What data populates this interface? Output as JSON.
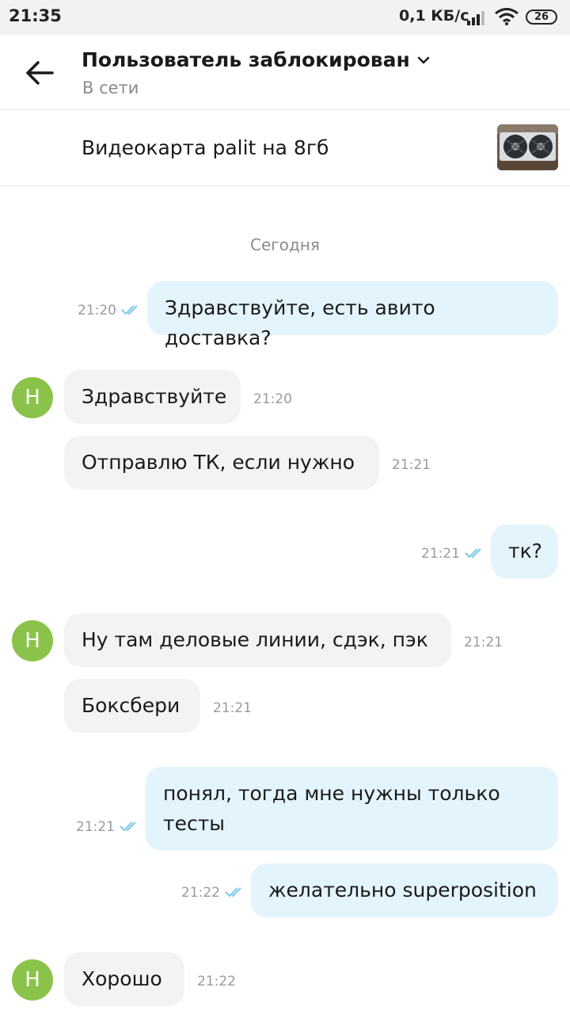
{
  "status_bar": {
    "time": "21:35",
    "network_speed": "0,1 КБ/с",
    "battery": "26"
  },
  "header": {
    "contact_name": "Пользователь заблокирован",
    "contact_status": "В сети"
  },
  "item_banner": {
    "title": "Видеокарта palit на 8гб"
  },
  "chat": {
    "date_divider": "Сегодня",
    "avatar_letter": "Н",
    "messages": [
      {
        "direction": "out",
        "text": "Здравствуйте, есть авито доставка?",
        "time": "21:20",
        "status": "read"
      },
      {
        "direction": "in",
        "text": "Здравствуйте",
        "time": "21:20"
      },
      {
        "direction": "in",
        "text": "Отправлю ТК, если нужно",
        "time": "21:21"
      },
      {
        "direction": "out",
        "text": "тк?",
        "time": "21:21",
        "status": "read"
      },
      {
        "direction": "in",
        "text": "Ну там деловые линии, сдэк, пэк",
        "time": "21:21"
      },
      {
        "direction": "in",
        "text": "Боксбери",
        "time": "21:21"
      },
      {
        "direction": "out",
        "text": "понял, тогда мне нужны только тесты",
        "time": "21:21",
        "status": "read"
      },
      {
        "direction": "out",
        "text": "желательно superposition",
        "time": "21:22",
        "status": "read"
      },
      {
        "direction": "in",
        "text": "Хорошо",
        "time": "21:22"
      }
    ]
  },
  "colors": {
    "outgoing_bubble": "#e3f4fd",
    "incoming_bubble": "#f3f3f3",
    "avatar": "#8bc34a",
    "read_check": "#7cc8ee"
  }
}
